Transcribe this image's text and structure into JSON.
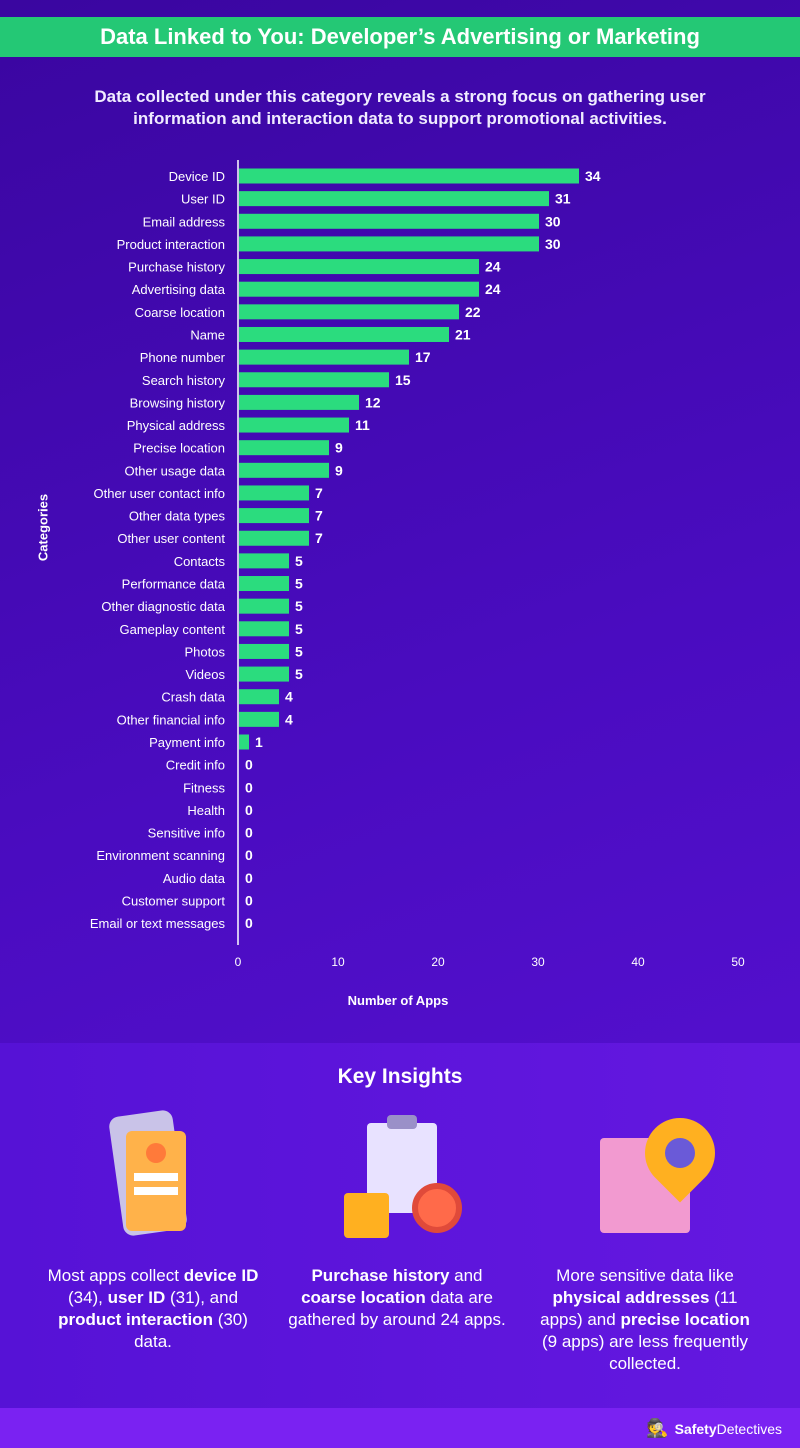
{
  "header": {
    "title": "Data Linked to You: Developer’s Advertising or Marketing",
    "subtitle": "Data collected under this category reveals a strong focus on gathering user information and interaction data to support promotional activities."
  },
  "chart_data": {
    "type": "bar",
    "orientation": "horizontal",
    "categories": [
      "Device ID",
      "User ID",
      "Email address",
      "Product interaction",
      "Purchase history",
      "Advertising data",
      "Coarse location",
      "Name",
      "Phone number",
      "Search history",
      "Browsing history",
      "Physical address",
      "Precise location",
      "Other usage data",
      "Other user contact info",
      "Other data types",
      "Other user content",
      "Contacts",
      "Performance data",
      "Other diagnostic data",
      "Gameplay content",
      "Photos",
      "Videos",
      "Crash data",
      "Other financial info",
      "Payment info",
      "Credit info",
      "Fitness",
      "Health",
      "Sensitive info",
      "Environment scanning",
      "Audio data",
      "Customer support",
      "Email or text messages"
    ],
    "values": [
      34,
      31,
      30,
      30,
      24,
      24,
      22,
      21,
      17,
      15,
      12,
      11,
      9,
      9,
      7,
      7,
      7,
      5,
      5,
      5,
      5,
      5,
      5,
      4,
      4,
      1,
      0,
      0,
      0,
      0,
      0,
      0,
      0,
      0
    ],
    "xlabel": "Number of Apps",
    "ylabel": "Categories",
    "xlim": [
      0,
      50
    ],
    "xticks": [
      0,
      10,
      20,
      30,
      40,
      50
    ],
    "grid": false,
    "bar_color": "#2bdc7e"
  },
  "insights": {
    "title": "Key Insights",
    "items": [
      {
        "parts": [
          [
            "Most apps collect ",
            false
          ],
          [
            "device ID",
            true
          ],
          [
            " (34), ",
            false
          ],
          [
            "user ID",
            true
          ],
          [
            " (31), and ",
            false
          ],
          [
            "product interaction",
            true
          ],
          [
            " (30) data.",
            false
          ]
        ],
        "icon": "smartphone-profile-icon"
      },
      {
        "parts": [
          [
            "Purchase history",
            true
          ],
          [
            " and ",
            false
          ],
          [
            "coarse location",
            true
          ],
          [
            " data are gathered by around 24 apps.",
            false
          ]
        ],
        "icon": "shopping-clipboard-icon"
      },
      {
        "parts": [
          [
            "More sensitive data like ",
            false
          ],
          [
            "physical addresses",
            true
          ],
          [
            " (11 apps) and ",
            false
          ],
          [
            "precise location",
            true
          ],
          [
            " (9 apps) are less frequently collected.",
            false
          ]
        ],
        "icon": "map-pin-home-icon"
      }
    ]
  },
  "footer": {
    "brand_bold": "Safety",
    "brand_rest": "Detectives"
  }
}
